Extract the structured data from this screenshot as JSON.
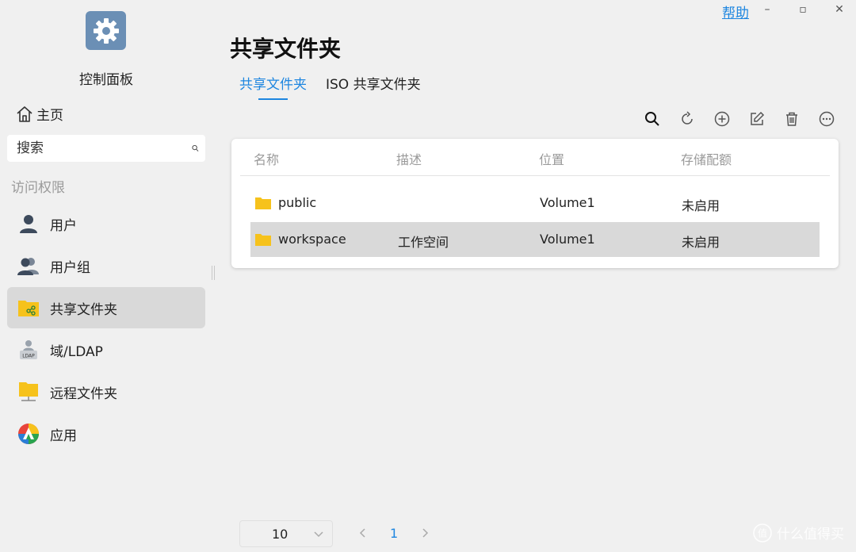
{
  "window": {
    "help_label": "帮助",
    "minimize": "–",
    "maximize": "▫",
    "close": "✕"
  },
  "sidebar": {
    "app_title": "控制面板",
    "home_label": "主页",
    "search_placeholder": "搜索",
    "section_label": "访问权限",
    "items": [
      {
        "label": "用户",
        "icon": "user-icon",
        "active": false
      },
      {
        "label": "用户组",
        "icon": "user-group-icon",
        "active": false
      },
      {
        "label": "共享文件夹",
        "icon": "shared-folder-icon",
        "active": true
      },
      {
        "label": "域/LDAP",
        "icon": "ldap-icon",
        "active": false
      },
      {
        "label": "远程文件夹",
        "icon": "remote-folder-icon",
        "active": false
      },
      {
        "label": "应用",
        "icon": "app-icon",
        "active": false
      }
    ]
  },
  "main": {
    "title": "共享文件夹",
    "tabs": [
      {
        "label": "共享文件夹",
        "active": true
      },
      {
        "label": "ISO 共享文件夹",
        "active": false
      }
    ],
    "toolbar": [
      "search-icon",
      "refresh-icon",
      "add-icon",
      "edit-icon",
      "delete-icon",
      "more-icon"
    ],
    "table": {
      "columns": [
        "名称",
        "描述",
        "位置",
        "存储配额"
      ],
      "rows": [
        {
          "name": "public",
          "description": "",
          "location": "Volume1",
          "quota": "未启用",
          "selected": false
        },
        {
          "name": "workspace",
          "description": "工作空间",
          "location": "Volume1",
          "quota": "未启用",
          "selected": true
        }
      ]
    },
    "pagination": {
      "page_size": "10",
      "current_page": "1"
    }
  },
  "watermark": "什么值得买",
  "colors": {
    "accent": "#1e86e0",
    "folder": "#f6c21c",
    "selected_row": "#d9d9d9"
  }
}
